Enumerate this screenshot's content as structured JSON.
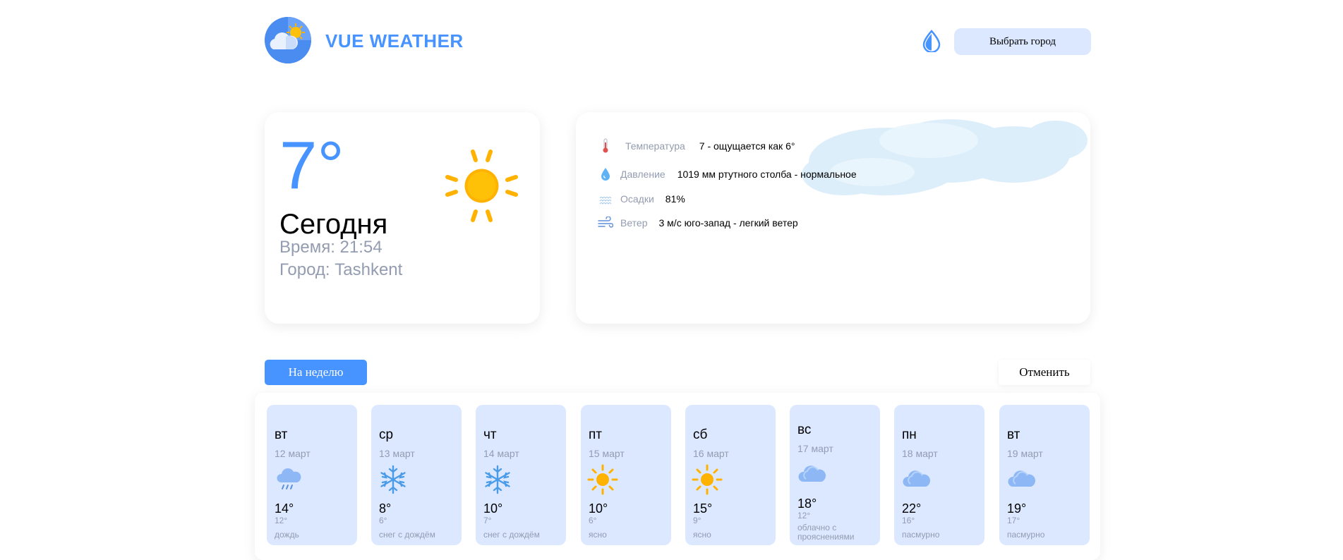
{
  "header": {
    "brand": "VUE WEATHER",
    "city_button_label": "Выбрать город",
    "logo_icon": "cloud-sun-icon",
    "theme_icon": "drop-icon"
  },
  "today": {
    "temp": "7°",
    "day": "Сегодня",
    "time": "Время: 21:54",
    "city": "Город: Tashkent",
    "icon": "sun-icon"
  },
  "details": {
    "temperature_label": "Температура",
    "temperature_value": "7 - ощущается как 6°",
    "pressure_label": "Давление",
    "pressure_value": "1019 мм ртутного столба - нормальное",
    "precip_label": "Осадки",
    "precip_value": "81%",
    "wind_label": "Ветер",
    "wind_value": "3 м/с юго-запад - легкий ветер"
  },
  "tabs": {
    "week_label": "На неделю",
    "cancel_label": "Отменить"
  },
  "colors": {
    "accent": "#4793ff",
    "card_bg": "#dbe8ff",
    "muted": "#939cb0",
    "sun": "#ffb300"
  },
  "forecast": [
    {
      "day": "вт",
      "date": "12 март",
      "icon": "rain-cloud-icon",
      "high": "14°",
      "low": "12°",
      "desc": "дождь"
    },
    {
      "day": "ср",
      "date": "13 март",
      "icon": "snowflake-icon",
      "high": "8°",
      "low": "6°",
      "desc": "снег с дождём"
    },
    {
      "day": "чт",
      "date": "14 март",
      "icon": "snowflake-icon",
      "high": "10°",
      "low": "7°",
      "desc": "снег с дождём"
    },
    {
      "day": "пт",
      "date": "15 март",
      "icon": "sun-icon",
      "high": "10°",
      "low": "6°",
      "desc": "ясно"
    },
    {
      "day": "сб",
      "date": "16 март",
      "icon": "sun-icon",
      "high": "15°",
      "low": "9°",
      "desc": "ясно"
    },
    {
      "day": "вс",
      "date": "17 март",
      "icon": "cloud-icon",
      "high": "18°",
      "low": "12°",
      "desc": "облачно с прояснениями"
    },
    {
      "day": "пн",
      "date": "18 март",
      "icon": "cloud-icon",
      "high": "22°",
      "low": "16°",
      "desc": "пасмурно"
    },
    {
      "day": "вт",
      "date": "19 март",
      "icon": "cloud-icon",
      "high": "19°",
      "low": "17°",
      "desc": "пасмурно"
    }
  ]
}
